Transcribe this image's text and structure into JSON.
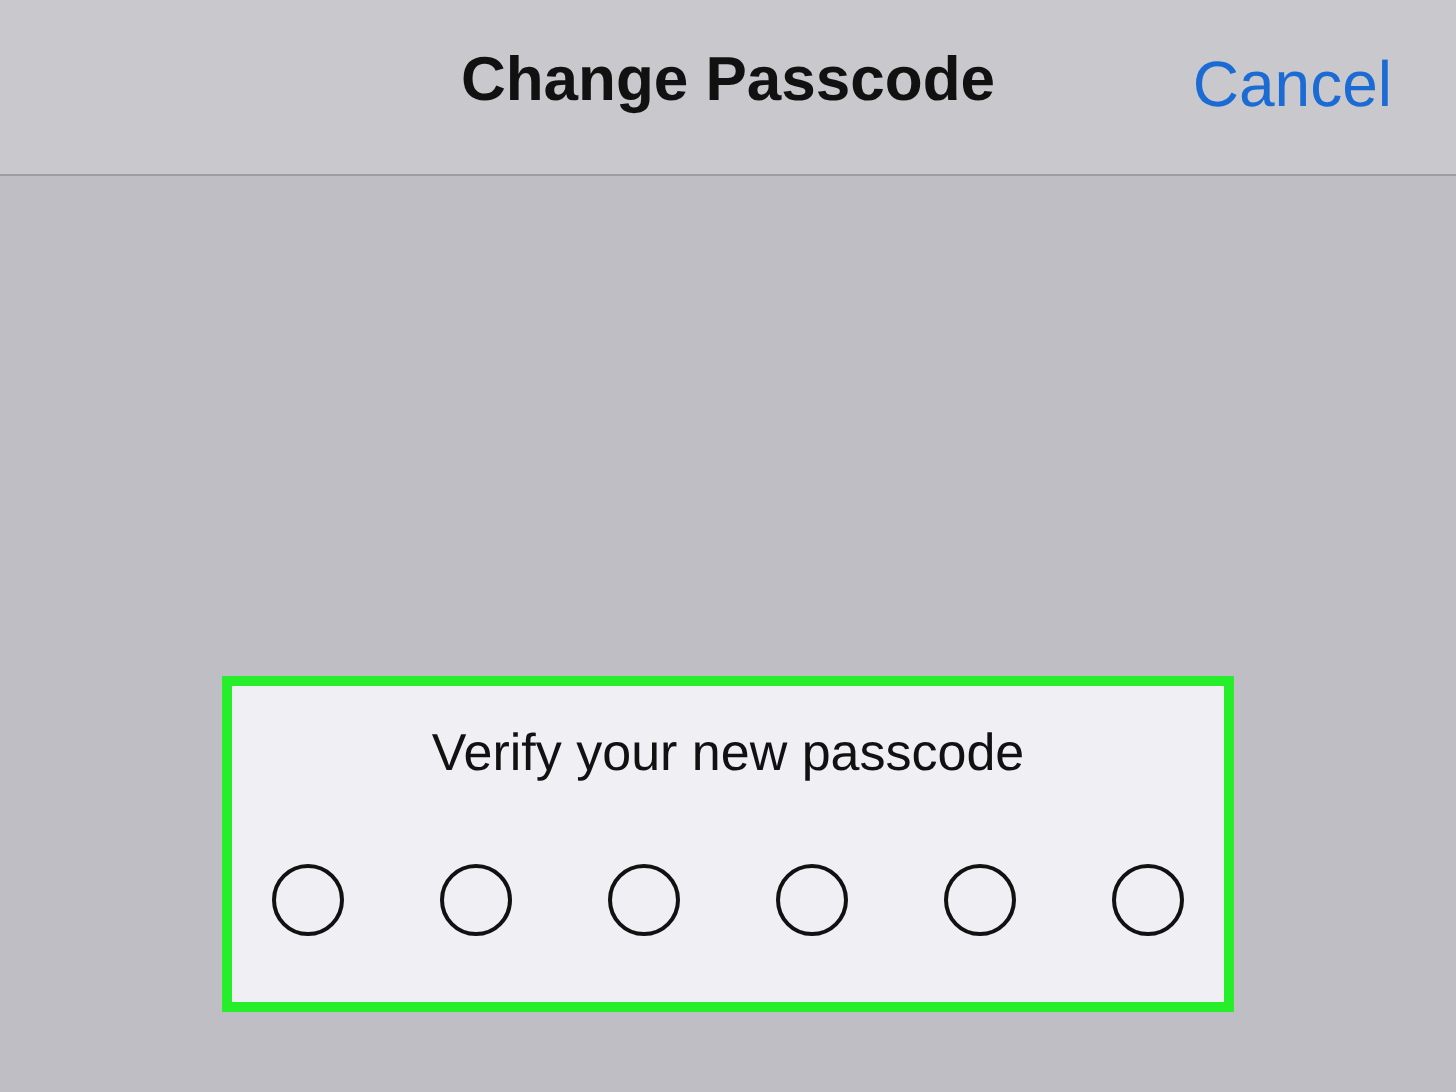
{
  "nav_bar": {
    "title": "Change Passcode",
    "cancel": "Cancel"
  },
  "prompt": "Verify your new passcode",
  "digits": [
    {
      "filled": false
    },
    {
      "filled": false
    },
    {
      "filled": false
    },
    {
      "filled": false
    },
    {
      "filled": false
    },
    {
      "filled": false
    }
  ]
}
